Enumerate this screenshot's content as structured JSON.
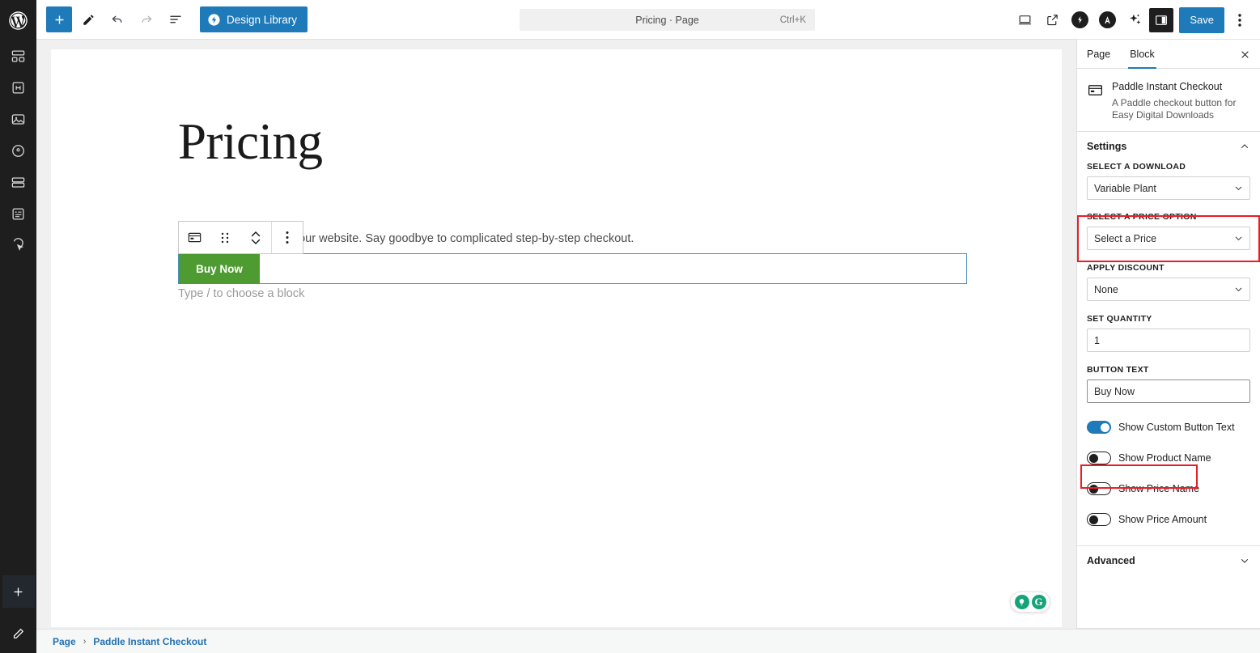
{
  "rail": {
    "logo_icon": "wordpress-logo-icon",
    "items": [
      {
        "icon": "layout-blocks-icon",
        "name": "rail-item-templates"
      },
      {
        "icon": "header-h-icon",
        "name": "rail-item-headers"
      },
      {
        "icon": "image-icon",
        "name": "rail-item-media"
      },
      {
        "icon": "target-gear-icon",
        "name": "rail-item-settings"
      },
      {
        "icon": "rows-stack-icon",
        "name": "rail-item-sections"
      },
      {
        "icon": "form-list-icon",
        "name": "rail-item-forms"
      },
      {
        "icon": "cursor-click-icon",
        "name": "rail-item-interactions"
      }
    ],
    "add_icon": "plus-icon",
    "edit_icon": "pencil-icon"
  },
  "toolbar": {
    "add_block_label": "+",
    "tools": [
      {
        "name": "add-block-button",
        "icon": "plus-icon"
      },
      {
        "name": "tools-edit-button",
        "icon": "pencil-icon"
      },
      {
        "name": "undo-button",
        "icon": "undo-arrow-icon"
      },
      {
        "name": "redo-button",
        "icon": "redo-arrow-icon"
      },
      {
        "name": "document-overview-button",
        "icon": "list-view-icon"
      }
    ],
    "design_library_label": "Design Library",
    "design_library_icon": "lightning-circle-icon",
    "command_title": "Pricing · Page",
    "command_shortcut": "Ctrl+K",
    "right_icons": [
      {
        "name": "view-device-button",
        "icon": "laptop-icon"
      },
      {
        "name": "view-preview-button",
        "icon": "external-link-icon"
      },
      {
        "name": "seedprod-button",
        "icon": "lightning-circle-icon"
      },
      {
        "name": "aioseo-button",
        "icon": "a-circle-icon"
      },
      {
        "name": "ai-assistant-button",
        "icon": "sparkles-icon"
      }
    ],
    "panel_toggle_icon": "sidebar-panel-icon",
    "save_label": "Save",
    "more_icon": "vertical-ellipsis-icon"
  },
  "editor": {
    "page_title": "Pricing",
    "block_toolbar": [
      {
        "name": "block-type-button",
        "icon": "credit-card-icon"
      },
      {
        "name": "drag-handle",
        "icon": "drag-dots-icon"
      },
      {
        "name": "move-updown-button",
        "icon": "chevron-updown-icon"
      },
      {
        "name": "block-options-button",
        "icon": "vertical-ellipsis-icon"
      }
    ],
    "block_description": "heckout anywhere on your website. Say goodbye to complicated step-by-step checkout.",
    "buy_button_label": "Buy Now",
    "buy_button_color": "#4d9b31",
    "empty_block_placeholder": "Type / to choose a block",
    "grammarly": {
      "bulb_icon": "lightbulb-icon",
      "logo_text": "G"
    }
  },
  "sidebar": {
    "tabs": [
      {
        "label": "Page",
        "active": false,
        "name": "tab-page"
      },
      {
        "label": "Block",
        "active": true,
        "name": "tab-block"
      }
    ],
    "close_icon": "close-icon",
    "block": {
      "icon": "credit-card-icon",
      "title": "Paddle Instant Checkout",
      "description": "A Paddle checkout button for Easy Digital Downloads"
    },
    "settings": {
      "header": "Settings",
      "expanded": true,
      "chevron": "chevron-up-icon",
      "fields": [
        {
          "label": "SELECT A DOWNLOAD",
          "type": "select",
          "value": "Variable Plant",
          "name": "select-a-download"
        },
        {
          "label": "SELECT A PRICE OPTION",
          "type": "select",
          "value": "Select a Price",
          "name": "select-a-price-option",
          "highlighted": true
        },
        {
          "label": "APPLY DISCOUNT",
          "type": "select",
          "value": "None",
          "name": "apply-discount"
        },
        {
          "label": "SET QUANTITY",
          "type": "text",
          "value": "1",
          "name": "set-quantity"
        },
        {
          "label": "BUTTON TEXT",
          "type": "text",
          "value": "Buy Now",
          "name": "button-text"
        }
      ],
      "toggles": [
        {
          "label": "Show Custom Button Text",
          "on": true,
          "name": "toggle-show-custom-button-text"
        },
        {
          "label": "Show Product Name",
          "on": false,
          "name": "toggle-show-product-name"
        },
        {
          "label": "Show Price Name",
          "on": false,
          "name": "toggle-show-price-name",
          "highlighted": true
        },
        {
          "label": "Show Price Amount",
          "on": false,
          "name": "toggle-show-price-amount"
        }
      ]
    },
    "advanced": {
      "header": "Advanced",
      "expanded": false,
      "chevron": "chevron-down-icon"
    }
  },
  "breadcrumb": {
    "items": [
      "Page",
      "Paddle Instant Checkout"
    ],
    "separator": "›"
  },
  "colors": {
    "accent": "#1e7ab8",
    "highlight": "#ed1c24",
    "button_green": "#4d9b31",
    "rail_bg": "#1e1e1e"
  }
}
